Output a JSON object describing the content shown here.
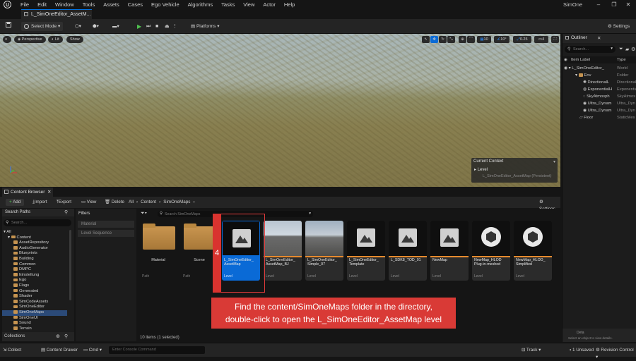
{
  "menubar": {
    "items": [
      "File",
      "Edit",
      "Window",
      "Tools",
      "Assets",
      "Cases",
      "Ego Vehicle",
      "Algorithms",
      "Tasks",
      "View",
      "Actor",
      "Help"
    ],
    "app_title": "SimOne"
  },
  "tab": {
    "title": "L_SimOneEditor_AssetM..."
  },
  "toolbar": {
    "select_mode": "Select Mode",
    "platforms": "Platforms",
    "settings": "Settings"
  },
  "viewport": {
    "perspective": "Perspective",
    "lit": "Lit",
    "show": "Show",
    "grid_size": "10",
    "rot_size": "10°",
    "scale_size": "0.25",
    "cam_speed": "4",
    "current_context": {
      "title": "Current Context",
      "level_label": "Level",
      "level_value": "L_SimOneEditor_AssetMap (Persistent)"
    }
  },
  "outliner": {
    "title": "Outliner",
    "search_placeholder": "Search...",
    "col_label": "Item Label",
    "col_type": "Type",
    "rows": [
      {
        "label": "L_SimOneEditor_",
        "type": "World"
      },
      {
        "label": "Env",
        "type": "Folder"
      },
      {
        "label": "DirectionalL",
        "type": "Directional"
      },
      {
        "label": "ExponentialH",
        "type": "Exponentia"
      },
      {
        "label": "SkyAtmosph",
        "type": "SkyAtmos"
      },
      {
        "label": "Ultra_Dynam",
        "type": "Ultra_Dyn"
      },
      {
        "label": "Ultra_Dynam",
        "type": "Ultra_Dyn"
      },
      {
        "label": "Floor",
        "type": "StaticMes"
      }
    ],
    "details_hint": "Select an object to view details.",
    "details_title": "Deta"
  },
  "content_browser": {
    "tab_title": "Content Browser",
    "add": "Add",
    "import": "Import",
    "export": "Export",
    "view": "View",
    "delete": "Delete",
    "breadcrumb": [
      "All",
      "Content",
      "SimOneMaps"
    ],
    "settings": "Settings",
    "search_paths": "Search Paths",
    "search_placeholder": "Search...",
    "search_assets_placeholder": "Search SimOneMaps",
    "filters": "Filters",
    "filter_items": [
      "Material",
      "Level Sequence"
    ],
    "tree": [
      "All",
      "Content",
      "AssetRepository",
      "AudioGenerator",
      "Blueprints",
      "Building",
      "Common",
      "DMPC",
      "Einstellung",
      "Ego",
      "Flags",
      "Generated",
      "Shader",
      "SimCodeAssets",
      "SimOneEditor",
      "SimOneMaps",
      "SimOneUI",
      "Sound",
      "Terrain"
    ],
    "collections": "Collections",
    "folders": [
      {
        "name": "Material",
        "type": "Path"
      },
      {
        "name": "Scene",
        "type": "Path"
      }
    ],
    "assets": [
      {
        "name": "L_SimOneEditor_ AssetMap",
        "type": "Level"
      },
      {
        "name": "L_SimOneEditor_ AssetMap_BJ",
        "type": "Level"
      },
      {
        "name": "L_SimOneEditor_ Simple_07",
        "type": "Level"
      },
      {
        "name": "L_SimOneEditor_ Template",
        "type": "Level"
      },
      {
        "name": "L_SDK8_TOD_01",
        "type": "Level"
      },
      {
        "name": "NewMap",
        "type": "Level"
      },
      {
        "name": "NewMap_HLOD Plug-in-meshed",
        "type": "Level"
      },
      {
        "name": "NewMap_HLOD_ Simplified",
        "type": "Level"
      }
    ],
    "item_count": "10 items (1 selected)"
  },
  "status": {
    "collect": "Collect",
    "content_drawer": "Content Drawer",
    "cmd": "Cmd",
    "console_placeholder": "Enter Console Command",
    "track": "Track",
    "unsaved": "1 Unsaved",
    "revision": "Revision Control"
  },
  "annotation": {
    "step": "4",
    "line1": "Find the content/SimOneMaps folder in the directory,",
    "line2": "double-click to open the L_SimOneEditor_AssetMap level"
  },
  "colors": {
    "accent": "#0070e0",
    "selected_tile": "#0a6ad6",
    "level_bar": "#e68a2e",
    "annotation": "#d93a36"
  }
}
